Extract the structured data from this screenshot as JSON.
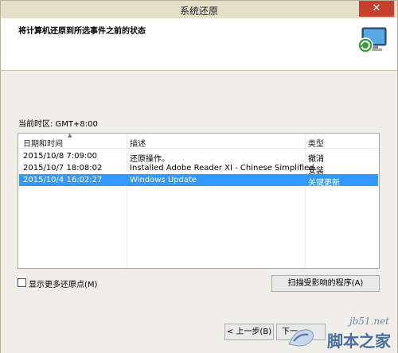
{
  "window": {
    "title": "系统还原",
    "close_glyph": "✕"
  },
  "header": {
    "text": "将计算机还原到所选事件之前的状态",
    "icon": "computer-restore-icon"
  },
  "timezone": {
    "label": "当前时区: GMT+8:00"
  },
  "table": {
    "columns": [
      "日期和时间",
      "描述",
      "类型"
    ],
    "rows": [
      {
        "datetime": "2015/10/8 7:09:00",
        "description": "还原操作。",
        "type": "撤消",
        "selected": false
      },
      {
        "datetime": "2015/10/7 18:08:02",
        "description": "Installed Adobe Reader XI - Chinese Simplified.",
        "type": "安装",
        "selected": false
      },
      {
        "datetime": "2015/10/4 16:02:27",
        "description": "Windows Update",
        "type": "关键更新",
        "selected": true
      }
    ],
    "selection_color": "#3399ff"
  },
  "show_more": {
    "label": "显示更多还原点(M)"
  },
  "buttons": {
    "scan": "扫描受影响的程序(A)",
    "back": "< 上一步(B)",
    "next": "下一"
  },
  "watermark": {
    "url": "jb51.net",
    "name": "脚本之家"
  }
}
